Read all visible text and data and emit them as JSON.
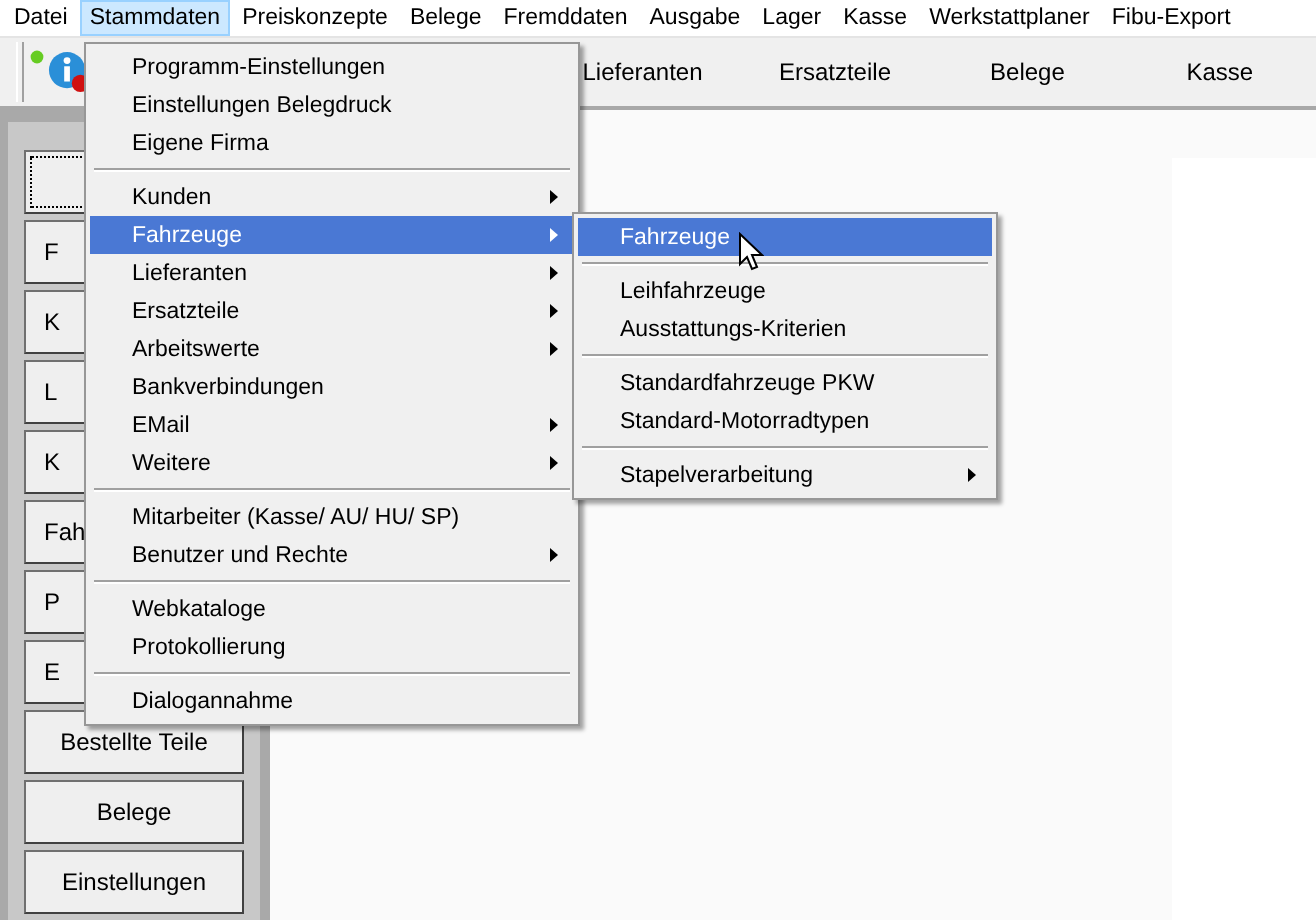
{
  "menubar": [
    {
      "label": "Datei",
      "selected": false
    },
    {
      "label": "Stammdaten",
      "selected": true
    },
    {
      "label": "Preiskonzepte",
      "selected": false
    },
    {
      "label": "Belege",
      "selected": false
    },
    {
      "label": "Fremddaten",
      "selected": false
    },
    {
      "label": "Ausgabe",
      "selected": false
    },
    {
      "label": "Lager",
      "selected": false
    },
    {
      "label": "Kasse",
      "selected": false
    },
    {
      "label": "Werkstattplaner",
      "selected": false
    },
    {
      "label": "Fibu-Export",
      "selected": false
    }
  ],
  "toolbar": {
    "items": [
      {
        "label": "Lieferanten"
      },
      {
        "label": "Ersatzteile"
      },
      {
        "label": "Belege"
      },
      {
        "label": "Kasse"
      }
    ]
  },
  "side_buttons": [
    {
      "kind": "covered",
      "focused": true
    },
    {
      "kind": "covered",
      "label": "F",
      "focused": false
    },
    {
      "kind": "covered",
      "label": "K",
      "focused": false
    },
    {
      "kind": "covered",
      "label": "L",
      "focused": false
    },
    {
      "kind": "covered",
      "label": "K",
      "focused": false
    },
    {
      "kind": "covered",
      "label": "Fah",
      "focused": false
    },
    {
      "kind": "covered",
      "label": "P",
      "focused": false
    },
    {
      "kind": "covered",
      "label": "E",
      "focused": false
    },
    {
      "kind": "full",
      "label": "Bestellte Teile",
      "focused": false
    },
    {
      "kind": "full",
      "label": "Belege",
      "focused": false
    },
    {
      "kind": "full",
      "label": "Einstellungen",
      "focused": false
    }
  ],
  "menu": {
    "items": [
      {
        "kind": "item",
        "label": "Programm-Einstellungen",
        "submenu": false,
        "selected": false
      },
      {
        "kind": "item",
        "label": "Einstellungen Belegdruck",
        "submenu": false,
        "selected": false
      },
      {
        "kind": "item",
        "label": "Eigene Firma",
        "submenu": false,
        "selected": false
      },
      {
        "kind": "separator"
      },
      {
        "kind": "item",
        "label": "Kunden",
        "submenu": true,
        "selected": false
      },
      {
        "kind": "item",
        "label": "Fahrzeuge",
        "submenu": true,
        "selected": true
      },
      {
        "kind": "item",
        "label": "Lieferanten",
        "submenu": true,
        "selected": false
      },
      {
        "kind": "item",
        "label": "Ersatzteile",
        "submenu": true,
        "selected": false
      },
      {
        "kind": "item",
        "label": "Arbeitswerte",
        "submenu": true,
        "selected": false
      },
      {
        "kind": "item",
        "label": "Bankverbindungen",
        "submenu": false,
        "selected": false
      },
      {
        "kind": "item",
        "label": "EMail",
        "submenu": true,
        "selected": false
      },
      {
        "kind": "item",
        "label": "Weitere",
        "submenu": true,
        "selected": false
      },
      {
        "kind": "separator"
      },
      {
        "kind": "item",
        "label": "Mitarbeiter (Kasse/ AU/ HU/ SP)",
        "submenu": false,
        "selected": false
      },
      {
        "kind": "item",
        "label": "Benutzer und Rechte",
        "submenu": true,
        "selected": false
      },
      {
        "kind": "separator"
      },
      {
        "kind": "item",
        "label": "Webkataloge",
        "submenu": false,
        "selected": false
      },
      {
        "kind": "item",
        "label": "Protokollierung",
        "submenu": false,
        "selected": false
      },
      {
        "kind": "separator"
      },
      {
        "kind": "item",
        "label": "Dialogannahme",
        "submenu": false,
        "selected": false
      }
    ]
  },
  "submenu": {
    "items": [
      {
        "kind": "item",
        "label": "Fahrzeuge",
        "submenu": false,
        "selected": true
      },
      {
        "kind": "separator"
      },
      {
        "kind": "item",
        "label": "Leihfahrzeuge",
        "submenu": false,
        "selected": false
      },
      {
        "kind": "item",
        "label": "Ausstattungs-Kriterien",
        "submenu": false,
        "selected": false
      },
      {
        "kind": "separator"
      },
      {
        "kind": "item",
        "label": "Standardfahrzeuge PKW",
        "submenu": false,
        "selected": false
      },
      {
        "kind": "item",
        "label": "Standard-Motorradtypen",
        "submenu": false,
        "selected": false
      },
      {
        "kind": "separator"
      },
      {
        "kind": "item",
        "label": "Stapelverarbeitung",
        "submenu": true,
        "selected": false
      }
    ]
  }
}
